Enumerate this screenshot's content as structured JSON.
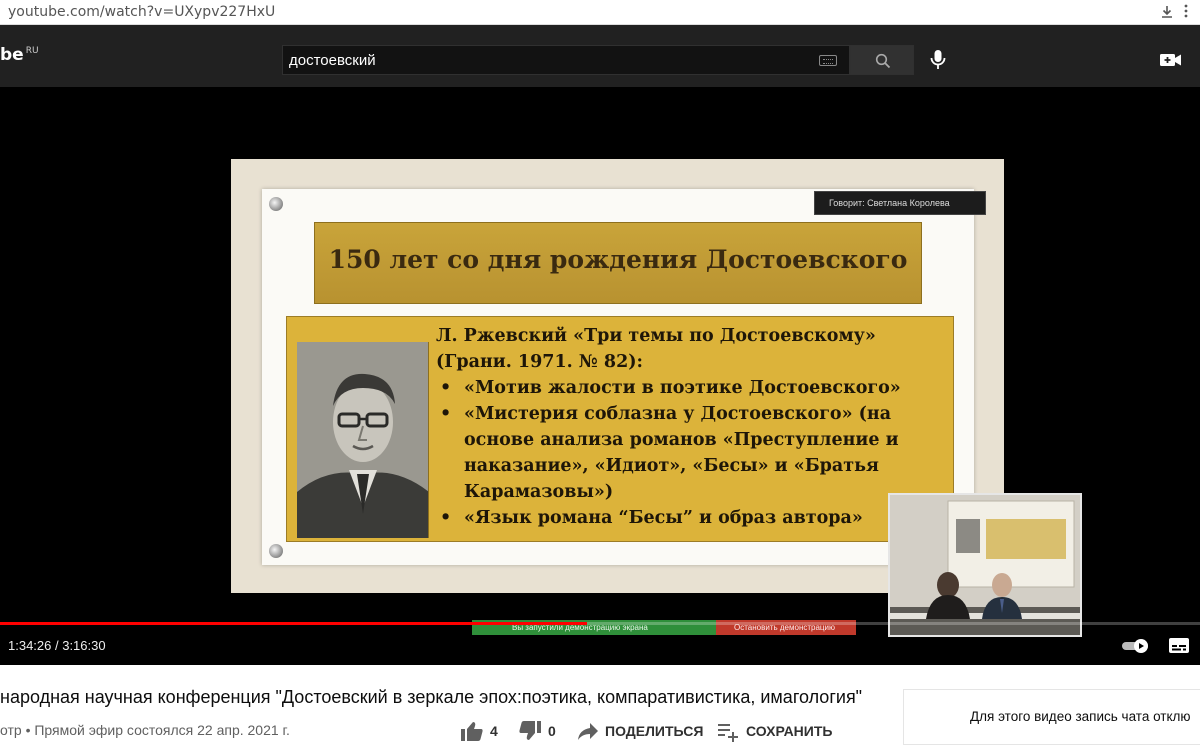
{
  "browser": {
    "url": "youtube.com/watch?v=UXypv227HxU"
  },
  "header": {
    "logo_text": "be",
    "logo_region": "RU",
    "search_value": "достоевский"
  },
  "player": {
    "slide": {
      "title": "150 лет со дня рождения Достоевского",
      "heading_line1": "Л. Ржевский «Три темы по Достоевскому»",
      "heading_line2": "(Грани. 1971. № 82):",
      "bullets": [
        "«Мотив жалости в поэтике Достоевского»",
        "«Мистерия соблазна у Достоевского» (на основе анализа романов «Преступление и наказание», «Идиот», «Бесы» и «Братья Карамазовы»)",
        "«Язык романа “Бесы” и образ автора»"
      ]
    },
    "speaker_label": "Говорит: Светлана Королева",
    "screen_share_text": "Вы запустили демонстрацию экрана",
    "stop_share_text": "Остановить демонстрацию",
    "time_display": "1:34:26 / 3:16:30",
    "progress_fraction": 0.489,
    "accent_color": "#ff0000"
  },
  "video_info": {
    "title": "народная научная конференция \"Достоевский в зеркале эпох:поэтика, компаративистика, имагология\"",
    "meta": "отр • Прямой эфир состоялся 22 апр. 2021 г.",
    "likes": "4",
    "dislikes": "0",
    "share_label": "ПОДЕЛИТЬСЯ",
    "save_label": "СОХРАНИТЬ"
  },
  "chat": {
    "notice": "Для этого видео запись чата отклю"
  }
}
